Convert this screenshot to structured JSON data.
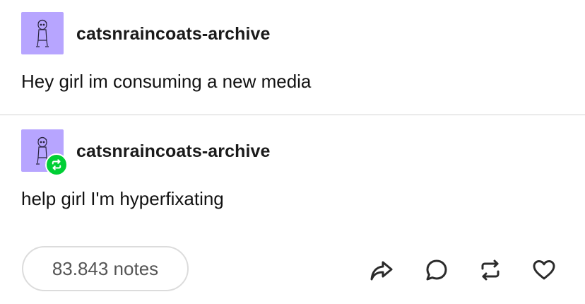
{
  "posts": [
    {
      "username": "catsnraincoats-archive",
      "text": "Hey girl im consuming a new media",
      "avatar_icon": "cat-girl-avatar-icon",
      "avatar_color": "#b7a5ff"
    },
    {
      "username": "catsnraincoats-archive",
      "text": "help girl I'm hyperfixating",
      "avatar_icon": "cat-girl-avatar-icon",
      "avatar_color": "#b7a5ff",
      "badge_icon": "reblog-badge-icon",
      "badge_color": "#00cf35"
    }
  ],
  "footer": {
    "notes_label": "83.843 notes",
    "actions": [
      "share-icon",
      "reply-icon",
      "reblog-icon",
      "like-icon"
    ]
  }
}
